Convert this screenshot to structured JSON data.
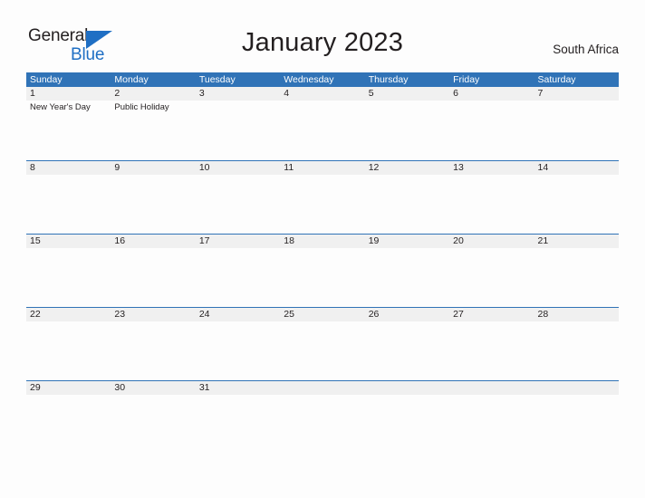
{
  "brand": {
    "name_part1": "General",
    "name_part2": "Blue",
    "triangle_icon": "triangle-flag-icon",
    "color_dark": "#231f20",
    "color_blue": "#1f6fc4"
  },
  "header": {
    "title": "January 2023",
    "country": "South Africa",
    "header_bg_color": "#3073b7"
  },
  "weekdays": [
    "Sunday",
    "Monday",
    "Tuesday",
    "Wednesday",
    "Thursday",
    "Friday",
    "Saturday"
  ],
  "calendar_data": {
    "month": "January",
    "year": 2023,
    "first_day_of_week": "Sunday",
    "weeks": [
      [
        {
          "day": "1",
          "events": [
            "New Year's Day"
          ]
        },
        {
          "day": "2",
          "events": [
            "Public Holiday"
          ]
        },
        {
          "day": "3",
          "events": []
        },
        {
          "day": "4",
          "events": []
        },
        {
          "day": "5",
          "events": []
        },
        {
          "day": "6",
          "events": []
        },
        {
          "day": "7",
          "events": []
        }
      ],
      [
        {
          "day": "8",
          "events": []
        },
        {
          "day": "9",
          "events": []
        },
        {
          "day": "10",
          "events": []
        },
        {
          "day": "11",
          "events": []
        },
        {
          "day": "12",
          "events": []
        },
        {
          "day": "13",
          "events": []
        },
        {
          "day": "14",
          "events": []
        }
      ],
      [
        {
          "day": "15",
          "events": []
        },
        {
          "day": "16",
          "events": []
        },
        {
          "day": "17",
          "events": []
        },
        {
          "day": "18",
          "events": []
        },
        {
          "day": "19",
          "events": []
        },
        {
          "day": "20",
          "events": []
        },
        {
          "day": "21",
          "events": []
        }
      ],
      [
        {
          "day": "22",
          "events": []
        },
        {
          "day": "23",
          "events": []
        },
        {
          "day": "24",
          "events": []
        },
        {
          "day": "25",
          "events": []
        },
        {
          "day": "26",
          "events": []
        },
        {
          "day": "27",
          "events": []
        },
        {
          "day": "28",
          "events": []
        }
      ],
      [
        {
          "day": "29",
          "events": []
        },
        {
          "day": "30",
          "events": []
        },
        {
          "day": "31",
          "events": []
        },
        {
          "day": "",
          "events": []
        },
        {
          "day": "",
          "events": []
        },
        {
          "day": "",
          "events": []
        },
        {
          "day": "",
          "events": []
        }
      ]
    ]
  }
}
